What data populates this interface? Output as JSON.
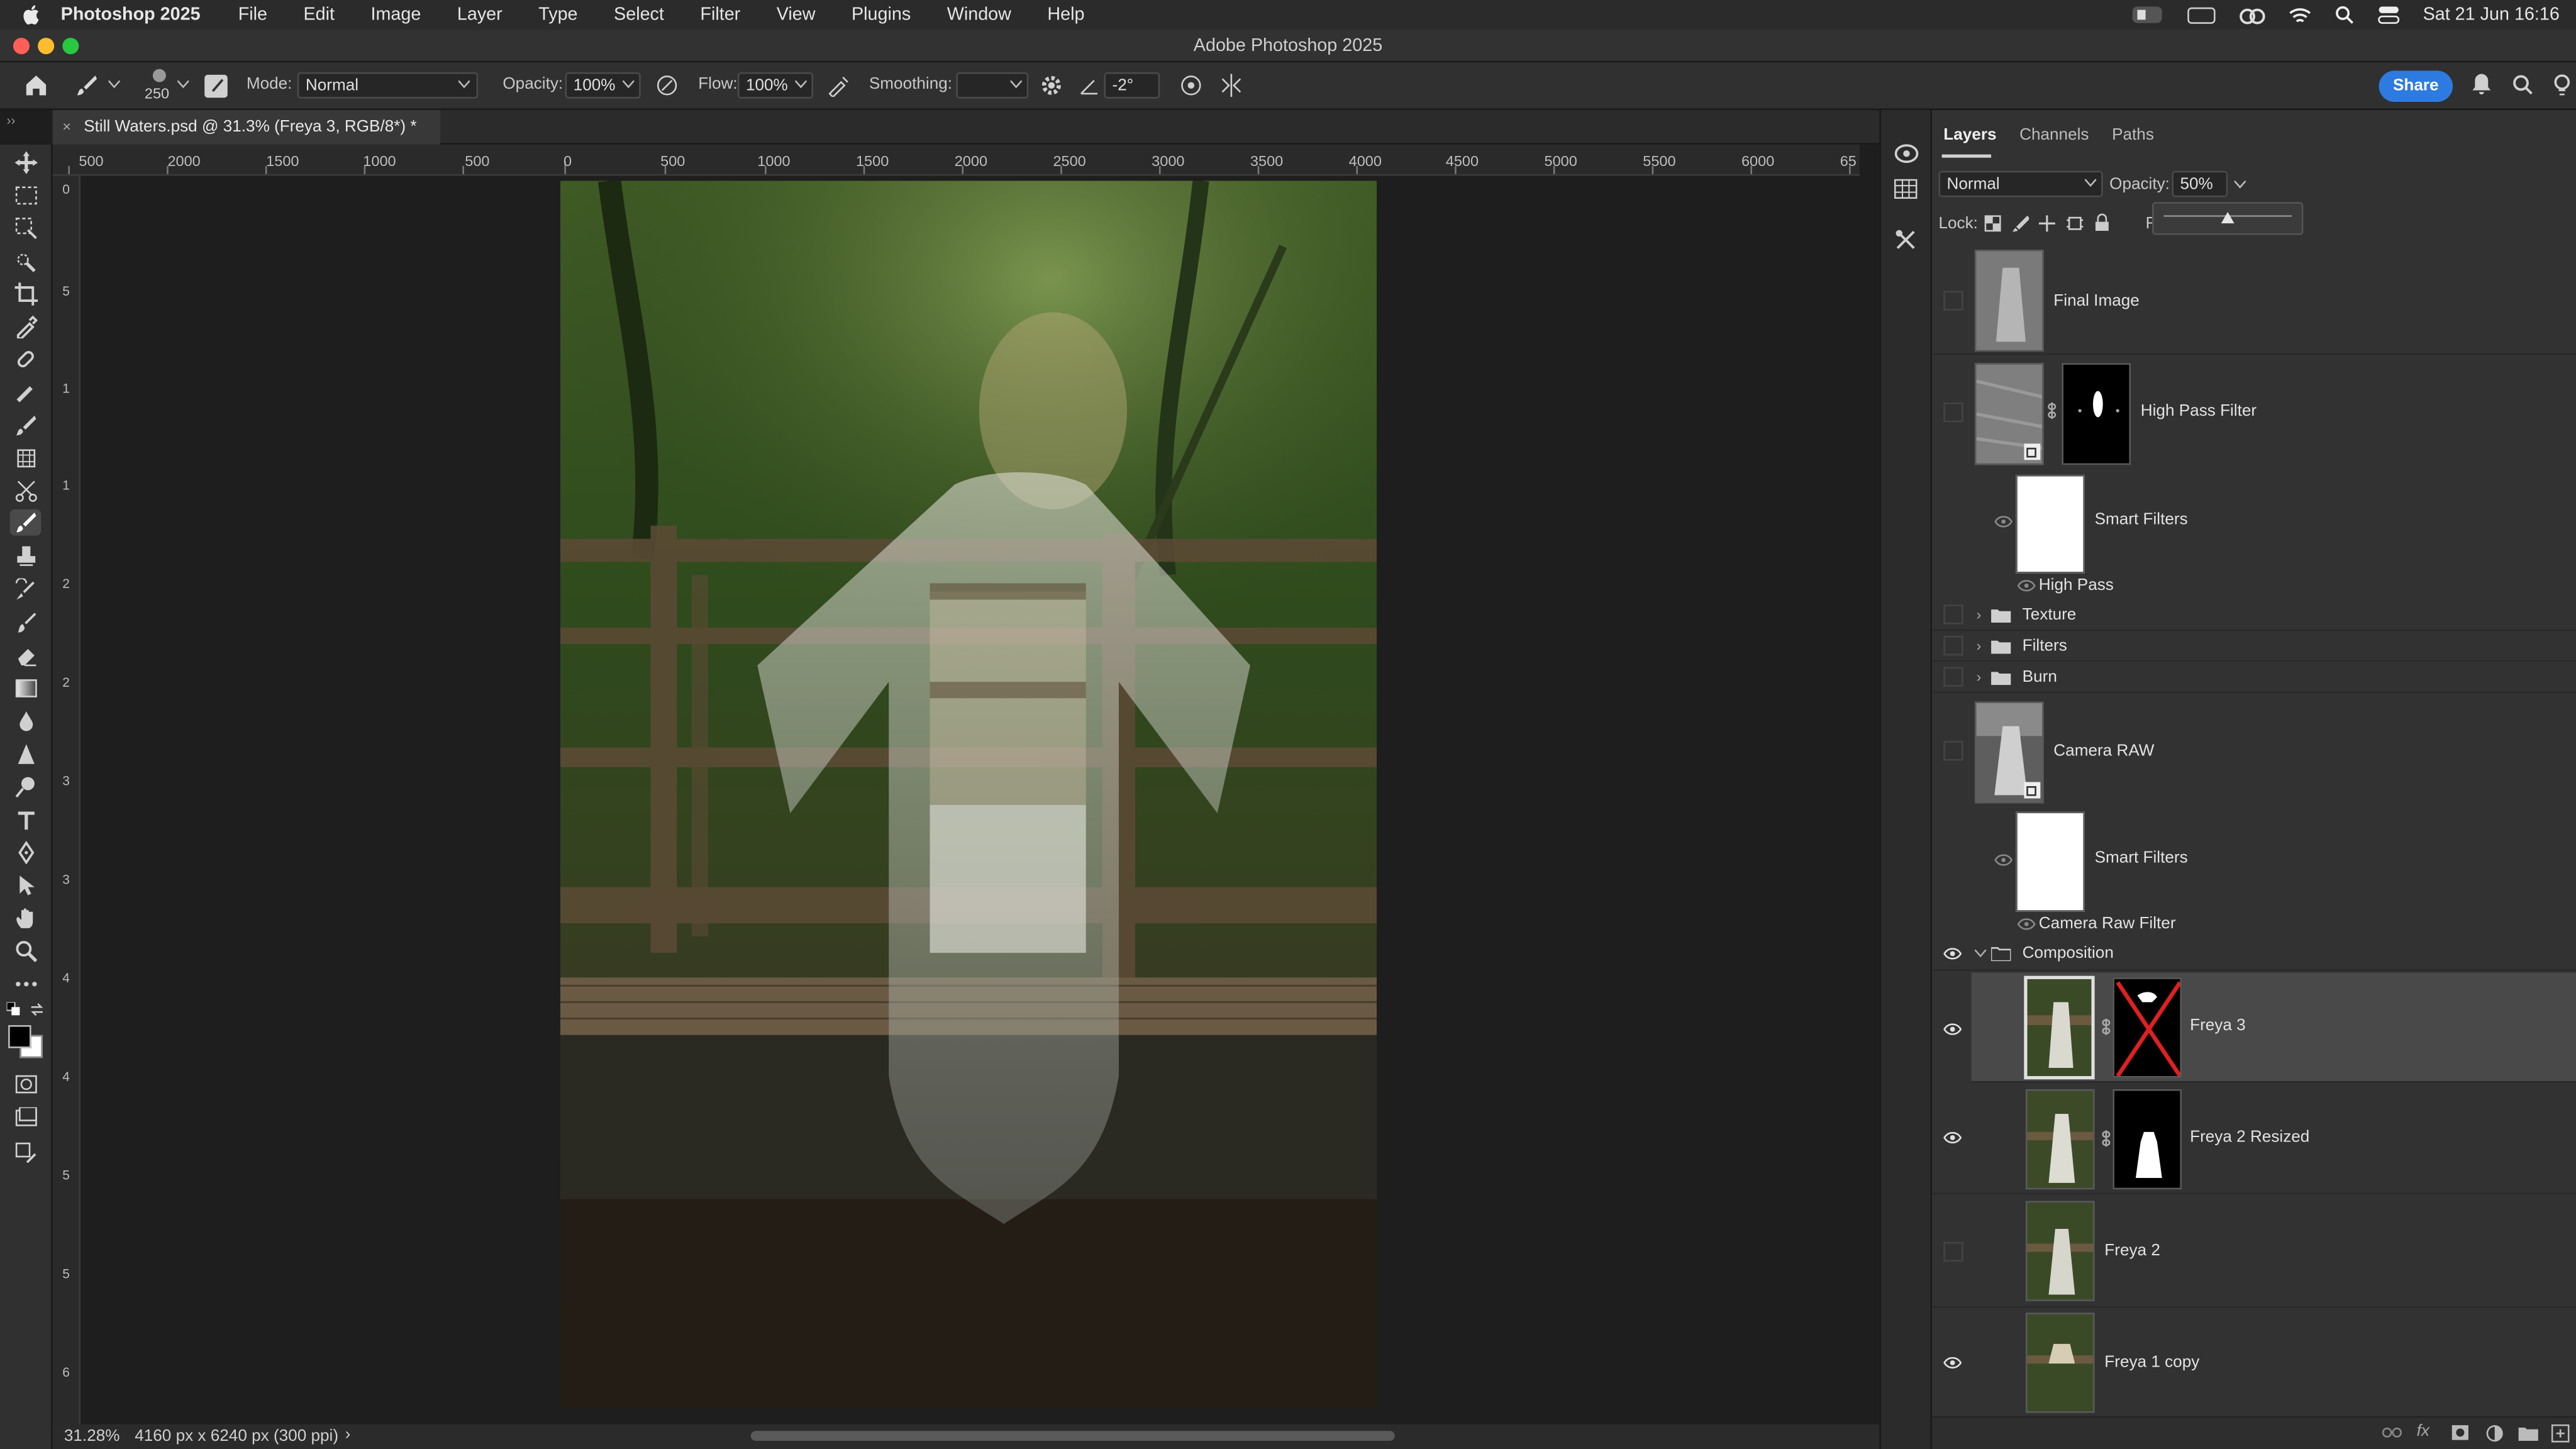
{
  "menu_bar": {
    "app_name": "Photoshop 2025",
    "items": [
      "File",
      "Edit",
      "Image",
      "Layer",
      "Type",
      "Select",
      "Filter",
      "View",
      "Plugins",
      "Window",
      "Help"
    ],
    "datetime": "Sat 21 Jun 16:16"
  },
  "window": {
    "title": "Adobe Photoshop 2025"
  },
  "options_bar": {
    "brush_size": "250",
    "mode_label": "Mode:",
    "mode_value": "Normal",
    "opacity_label": "Opacity:",
    "opacity_value": "100%",
    "flow_label": "Flow:",
    "flow_value": "100%",
    "smoothing_label": "Smoothing:",
    "smoothing_value": "",
    "angle_value": "-2°",
    "share_label": "Share"
  },
  "document": {
    "tab_title": "Still Waters.psd @ 31.3% (Freya 3, RGB/8*) *",
    "zoom": "31.28%",
    "dimensions": "4160 px x 6240 px (300 ppi)"
  },
  "rulers": {
    "horizontal": [
      "500",
      "2000",
      "1500",
      "1000",
      "500",
      "0",
      "500",
      "1000",
      "1500",
      "2000",
      "2500",
      "3000",
      "3500",
      "4000",
      "4500",
      "5000",
      "5500",
      "6000",
      "65"
    ],
    "vertical": [
      "0",
      "5",
      "1",
      "1",
      "2",
      "2",
      "3",
      "3",
      "4",
      "4",
      "5",
      "5",
      "6"
    ]
  },
  "layers_panel": {
    "tabs": [
      "Layers",
      "Channels",
      "Paths"
    ],
    "blend_mode": "Normal",
    "opacity_label": "Opacity:",
    "opacity_value": "50%",
    "opacity_slider_fraction": 0.5,
    "lock_label": "Lock:",
    "fill_label": "F",
    "layers": [
      {
        "name": "Final Image",
        "visible": false
      },
      {
        "name": "High Pass Filter",
        "visible": false
      },
      {
        "name": "Smart Filters",
        "visible": true
      },
      {
        "name": "High Pass",
        "visible": true
      },
      {
        "name": "Texture",
        "visible": false
      },
      {
        "name": "Filters",
        "visible": false
      },
      {
        "name": "Burn",
        "visible": false
      },
      {
        "name": "Camera RAW",
        "visible": false
      },
      {
        "name": "Smart Filters",
        "visible": true
      },
      {
        "name": "Camera Raw Filter",
        "visible": true
      },
      {
        "name": "Composition",
        "visible": true
      },
      {
        "name": "Freya 3",
        "visible": true,
        "selected": true
      },
      {
        "name": "Freya 2 Resized",
        "visible": true
      },
      {
        "name": "Freya 2",
        "visible": false
      },
      {
        "name": "Freya 1 copy",
        "visible": true
      }
    ]
  },
  "colors": {
    "accent": "#2d7be0",
    "panel_bg": "#323232",
    "selected_row": "#494949",
    "mask_disabled_x": "#e02020"
  }
}
